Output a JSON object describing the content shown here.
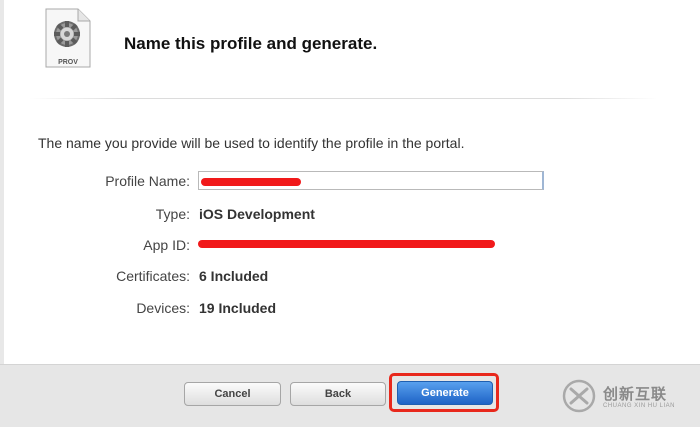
{
  "header": {
    "icon_label": "PROV",
    "title": "Name this profile and generate."
  },
  "form": {
    "intro": "The name you provide will be used to identify the profile in the portal.",
    "profile_name": {
      "label": "Profile Name:",
      "value": ""
    },
    "type": {
      "label": "Type:",
      "value": "iOS Development"
    },
    "app_id": {
      "label": "App ID:",
      "value": ""
    },
    "certificates": {
      "label": "Certificates:",
      "value": "6 Included"
    },
    "devices": {
      "label": "Devices:",
      "value": "19 Included"
    }
  },
  "footer": {
    "cancel_label": "Cancel",
    "back_label": "Back",
    "generate_label": "Generate"
  },
  "watermark": {
    "cn_text": "创新互联",
    "en_text": "CHUANG XIN HU LIAN"
  },
  "colors": {
    "redaction": "#f1191a",
    "highlight": "#e8281c",
    "primary_button": "#2a71d0"
  }
}
